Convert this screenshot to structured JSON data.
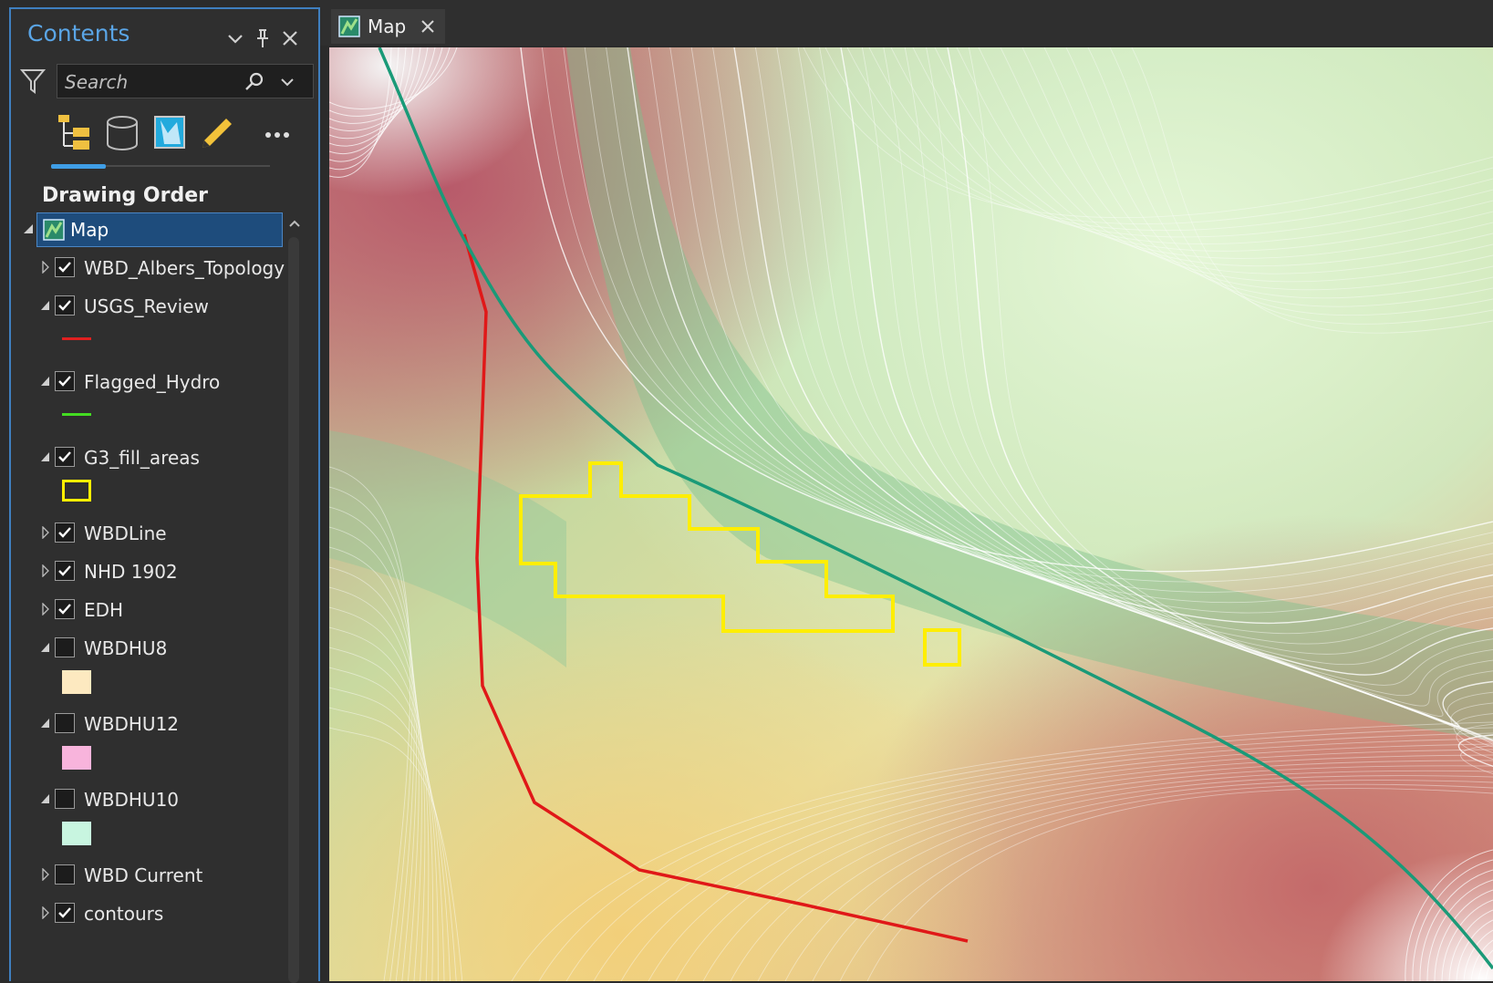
{
  "contents_pane": {
    "title": "Contents",
    "search_placeholder": "Search",
    "section_title": "Drawing Order",
    "map_node_label": "Map",
    "layers": [
      {
        "name": "WBD_Albers_Topology",
        "checked": true,
        "expanded": false,
        "symbol": "none"
      },
      {
        "name": "USGS_Review",
        "checked": true,
        "expanded": true,
        "symbol": "line",
        "symbol_color": "#e02020"
      },
      {
        "name": "Flagged_Hydro",
        "checked": true,
        "expanded": true,
        "symbol": "line",
        "symbol_color": "#44dd22"
      },
      {
        "name": "G3_fill_areas",
        "checked": true,
        "expanded": true,
        "symbol": "outline",
        "symbol_color": "#ffee00"
      },
      {
        "name": "WBDLine",
        "checked": true,
        "expanded": false,
        "symbol": "none"
      },
      {
        "name": "NHD 1902",
        "checked": true,
        "expanded": false,
        "symbol": "none"
      },
      {
        "name": "EDH",
        "checked": true,
        "expanded": false,
        "symbol": "none"
      },
      {
        "name": "WBDHU8",
        "checked": false,
        "expanded": true,
        "symbol": "fill",
        "symbol_color": "#fde9c0"
      },
      {
        "name": "WBDHU12",
        "checked": false,
        "expanded": true,
        "symbol": "fill",
        "symbol_color": "#f8b4dc"
      },
      {
        "name": "WBDHU10",
        "checked": false,
        "expanded": true,
        "symbol": "fill",
        "symbol_color": "#c8f5e0"
      },
      {
        "name": "WBD Current",
        "checked": false,
        "expanded": false,
        "symbol": "none"
      },
      {
        "name": "contours",
        "checked": true,
        "expanded": false,
        "symbol": "none"
      }
    ]
  },
  "map_tab": {
    "label": "Map"
  },
  "colors": {
    "accent": "#3f9ee6",
    "review_line": "#e01818",
    "boundary_line": "#1a9a78",
    "fill_area": "#ffee00"
  }
}
